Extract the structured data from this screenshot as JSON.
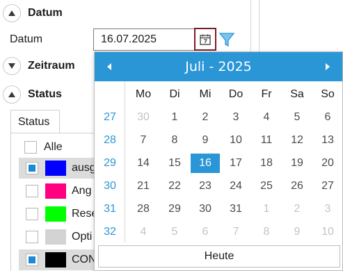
{
  "sections": {
    "datum": {
      "title": "Datum",
      "field_label": "Datum",
      "value": "16.07.2025"
    },
    "zeitraum": {
      "title": "Zeitraum"
    },
    "status": {
      "title": "Status"
    }
  },
  "status_tab": {
    "tab_label": "Status",
    "all_label": "Alle",
    "items": [
      {
        "label": "ausg",
        "color": "#0000ff",
        "checked": true,
        "selected": true
      },
      {
        "label": "Ang",
        "color": "#ff0080",
        "checked": false,
        "selected": false
      },
      {
        "label": "Rese",
        "color": "#00ff00",
        "checked": false,
        "selected": false
      },
      {
        "label": "Opti",
        "color": "#d3d3d3",
        "checked": false,
        "selected": false
      },
      {
        "label": "CON",
        "color": "#000000",
        "checked": true,
        "selected": true
      }
    ]
  },
  "calendar": {
    "title": "Juli - 2025",
    "prev_icon": "triangle-left-icon",
    "next_icon": "triangle-right-icon",
    "weekdays": [
      "Mo",
      "Di",
      "Mi",
      "Do",
      "Fr",
      "Sa",
      "So"
    ],
    "weeks": [
      {
        "number": "27",
        "days": [
          {
            "d": "30",
            "other": true
          },
          {
            "d": "1"
          },
          {
            "d": "2"
          },
          {
            "d": "3"
          },
          {
            "d": "4"
          },
          {
            "d": "5"
          },
          {
            "d": "6"
          }
        ]
      },
      {
        "number": "28",
        "days": [
          {
            "d": "7"
          },
          {
            "d": "8"
          },
          {
            "d": "9"
          },
          {
            "d": "10"
          },
          {
            "d": "11"
          },
          {
            "d": "12"
          },
          {
            "d": "13"
          }
        ]
      },
      {
        "number": "29",
        "days": [
          {
            "d": "14"
          },
          {
            "d": "15"
          },
          {
            "d": "16",
            "selected": true
          },
          {
            "d": "17"
          },
          {
            "d": "18"
          },
          {
            "d": "19"
          },
          {
            "d": "20"
          }
        ]
      },
      {
        "number": "30",
        "days": [
          {
            "d": "21"
          },
          {
            "d": "22"
          },
          {
            "d": "23"
          },
          {
            "d": "24"
          },
          {
            "d": "25"
          },
          {
            "d": "26"
          },
          {
            "d": "27"
          }
        ]
      },
      {
        "number": "31",
        "days": [
          {
            "d": "28"
          },
          {
            "d": "29"
          },
          {
            "d": "30"
          },
          {
            "d": "31"
          },
          {
            "d": "1",
            "other": true
          },
          {
            "d": "2",
            "other": true
          },
          {
            "d": "3",
            "other": true
          }
        ]
      },
      {
        "number": "32",
        "days": [
          {
            "d": "4",
            "other": true
          },
          {
            "d": "5",
            "other": true
          },
          {
            "d": "6",
            "other": true
          },
          {
            "d": "7",
            "other": true
          },
          {
            "d": "8",
            "other": true
          },
          {
            "d": "9",
            "other": true
          },
          {
            "d": "10",
            "other": true
          }
        ]
      }
    ],
    "today_label": "Heute"
  },
  "colors": {
    "accent": "#2a96d6",
    "calendar_button_border": "#7a1a2a",
    "filter_icon": "#2a96d6"
  }
}
